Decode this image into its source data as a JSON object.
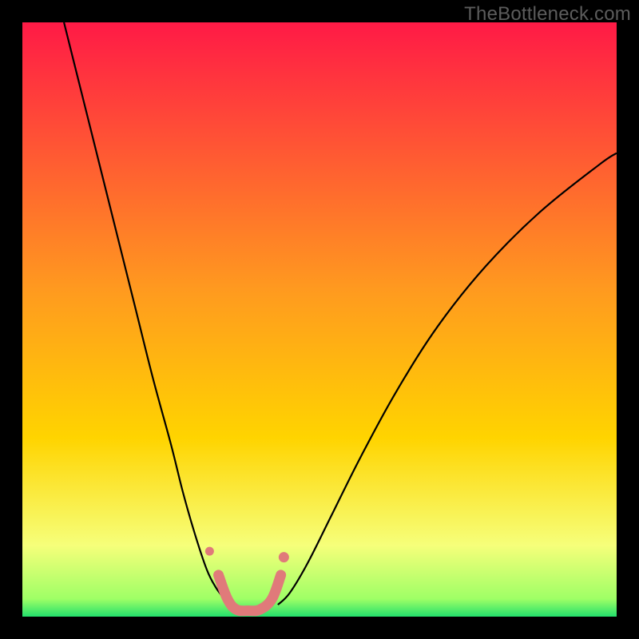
{
  "watermark": "TheBottleneck.com",
  "chart_data": {
    "type": "line",
    "title": "",
    "xlabel": "",
    "ylabel": "",
    "xlim": [
      0,
      100
    ],
    "ylim": [
      0,
      100
    ],
    "background_gradient_top": "#ff1a46",
    "background_gradient_mid": "#ffd400",
    "background_gradient_low": "#f6ff7a",
    "background_gradient_bottom": "#23e06c",
    "series": [
      {
        "name": "left-branch",
        "color": "#000000",
        "stroke_width": 2.2,
        "x": [
          7,
          10,
          13,
          16,
          19,
          22,
          25,
          27,
          29,
          31,
          32.5,
          34,
          35
        ],
        "y": [
          100,
          88,
          76,
          64,
          52,
          40,
          29,
          21,
          14,
          8,
          5,
          3,
          2
        ]
      },
      {
        "name": "right-branch",
        "color": "#000000",
        "stroke_width": 2.2,
        "x": [
          43,
          45,
          48,
          52,
          57,
          63,
          70,
          78,
          87,
          97,
          100
        ],
        "y": [
          2,
          4,
          9,
          17,
          27,
          38,
          49,
          59,
          68,
          76,
          78
        ]
      },
      {
        "name": "trough-highlight",
        "color": "#e07a7a",
        "stroke_width": 13,
        "linecap": "round",
        "x": [
          33,
          34.5,
          36,
          38,
          40,
          42,
          43.5
        ],
        "y": [
          7,
          3,
          1.2,
          1,
          1.2,
          3,
          7
        ]
      }
    ],
    "points": [
      {
        "name": "dot-upper-left",
        "x": 31.5,
        "y": 11,
        "r": 5.5,
        "color": "#e07a7a"
      },
      {
        "name": "dot-upper-right",
        "x": 44,
        "y": 10,
        "r": 6.5,
        "color": "#e07a7a"
      }
    ],
    "annotations": []
  }
}
